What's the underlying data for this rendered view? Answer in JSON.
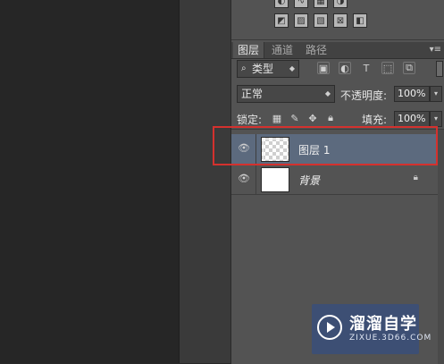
{
  "tabs": [
    {
      "label": "图层",
      "active": true
    },
    {
      "label": "通道",
      "active": false
    },
    {
      "label": "路径",
      "active": false
    }
  ],
  "filter": {
    "kind_label": "类型"
  },
  "blend": {
    "mode": "正常",
    "opacity_label": "不透明度:",
    "opacity_value": "100%"
  },
  "lock": {
    "label": "锁定:",
    "fill_label": "填充:",
    "fill_value": "100%"
  },
  "layers": [
    {
      "name": "图层 1",
      "selected": true,
      "thumb": "transparent"
    },
    {
      "name": "背景",
      "selected": false,
      "thumb": "white",
      "locked": true
    }
  ],
  "watermark": {
    "title": "溜溜自学",
    "url": "ZIXUE.3D66.COM"
  },
  "colors": {
    "selection": "#5c6a7e",
    "highlight_box": "#d4312e",
    "watermark_bg": "#3d4f74"
  }
}
